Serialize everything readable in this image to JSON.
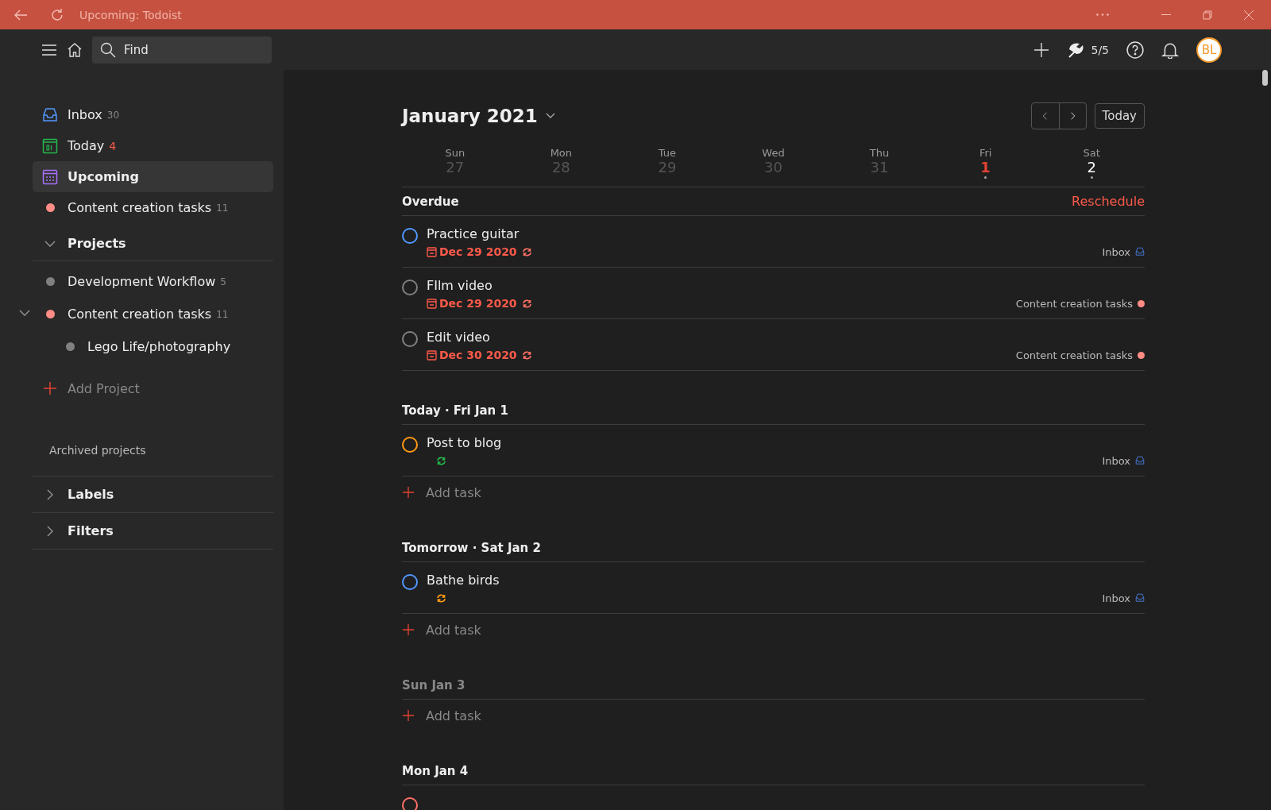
{
  "window": {
    "title": "Upcoming: Todoist"
  },
  "toolbar": {
    "search_placeholder": "Find",
    "karma": "5/5",
    "avatar": "BL"
  },
  "sidebar": {
    "nav": [
      {
        "kind": "inbox",
        "label": "Inbox",
        "count": "30",
        "count_alert": false,
        "selected": false
      },
      {
        "kind": "today",
        "label": "Today",
        "count": "4",
        "count_alert": true,
        "selected": false
      },
      {
        "kind": "upcoming",
        "label": "Upcoming",
        "selected": true
      },
      {
        "kind": "project",
        "label": "Content creation tasks",
        "count": "11",
        "count_alert": false,
        "color": "#ff8d85",
        "selected": false
      }
    ],
    "projects": {
      "label": "Projects",
      "expanded": true,
      "items": [
        {
          "label": "Development Workflow",
          "count": "5",
          "color": "#808080"
        },
        {
          "label": "Content creation tasks",
          "count": "11",
          "color": "#ff8d85",
          "expanded": true,
          "children": [
            {
              "label": "Lego Life/photography",
              "color": "#808080"
            }
          ]
        }
      ]
    },
    "add_project": "Add Project",
    "archived": "Archived projects",
    "sections": [
      {
        "label": "Labels",
        "expanded": false
      },
      {
        "label": "Filters",
        "expanded": false
      }
    ]
  },
  "main": {
    "month": "January 2021",
    "today_button": "Today",
    "days": [
      {
        "weekday": "Sun",
        "date": "27",
        "past": true,
        "today": false,
        "has_tasks": false
      },
      {
        "weekday": "Mon",
        "date": "28",
        "past": true,
        "today": false,
        "has_tasks": false
      },
      {
        "weekday": "Tue",
        "date": "29",
        "past": true,
        "today": false,
        "has_tasks": false
      },
      {
        "weekday": "Wed",
        "date": "30",
        "past": true,
        "today": false,
        "has_tasks": false
      },
      {
        "weekday": "Thu",
        "date": "31",
        "past": true,
        "today": false,
        "has_tasks": false
      },
      {
        "weekday": "Fri",
        "date": "1",
        "past": false,
        "today": true,
        "has_tasks": true
      },
      {
        "weekday": "Sat",
        "date": "2",
        "past": false,
        "today": false,
        "has_tasks": true
      }
    ],
    "sections": [
      {
        "kind": "overdue",
        "title": "Overdue",
        "muted": false,
        "action": "Reschedule",
        "tasks": [
          {
            "title": "Practice guitar",
            "color": "#5297ff",
            "due": "Dec 29 2020",
            "recurring": true,
            "project": {
              "kind": "inbox",
              "name": "Inbox"
            }
          },
          {
            "title": "FIlm video",
            "color": "#808080",
            "due": "Dec 29 2020",
            "recurring": true,
            "project": {
              "kind": "dot",
              "name": "Content creation tasks",
              "color": "#ff8d85"
            }
          },
          {
            "title": "Edit video",
            "color": "#808080",
            "due": "Dec 30 2020",
            "recurring": true,
            "project": {
              "kind": "dot",
              "name": "Content creation tasks",
              "color": "#ff8d85"
            }
          }
        ]
      },
      {
        "kind": "today",
        "title": "Today · Fri Jan 1",
        "muted": false,
        "add_task": "Add task",
        "tasks": [
          {
            "title": "Post to blog",
            "color": "#ff9a14",
            "recurring": true,
            "project": {
              "kind": "inbox",
              "name": "Inbox"
            }
          }
        ]
      },
      {
        "kind": "tomorrow",
        "title": "Tomorrow · Sat Jan 2",
        "muted": false,
        "add_task": "Add task",
        "tasks": [
          {
            "title": "Bathe birds",
            "color": "#5297ff",
            "recurring": true,
            "project": {
              "kind": "inbox",
              "name": "Inbox"
            }
          }
        ]
      },
      {
        "title": "Sun Jan 3",
        "muted": true,
        "add_task": "Add task"
      },
      {
        "title": "Mon Jan 4",
        "muted": false,
        "tasks": [
          {
            "color": "#ff7066"
          }
        ]
      }
    ]
  }
}
